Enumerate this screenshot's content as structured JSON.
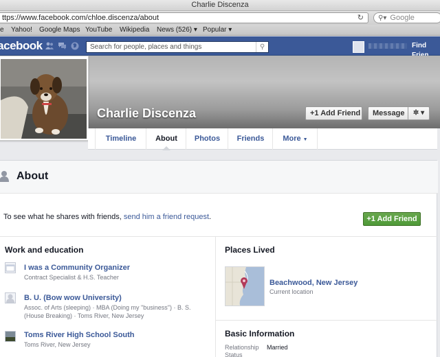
{
  "browser": {
    "window_title": "Charlie Discenza",
    "url": "ttps://www.facebook.com/chloe.discenza/about",
    "search_placeholder": "Google",
    "bookmarks": [
      "e",
      "Yahoo!",
      "Google Maps",
      "YouTube",
      "Wikipedia",
      "News (526) ▾",
      "Popular ▾"
    ]
  },
  "fb": {
    "logo": "facebook",
    "search_placeholder": "Search for people, places and things",
    "find_friends": "Find Frien"
  },
  "profile": {
    "name": "Charlie Discenza",
    "add_friend_label": "+1 Add Friend",
    "message_label": "Message",
    "gear_label": "✲ ▾"
  },
  "tabs": [
    {
      "label": "Timeline",
      "active": false
    },
    {
      "label": "About",
      "active": true
    },
    {
      "label": "Photos",
      "active": false
    },
    {
      "label": "Friends",
      "active": false
    },
    {
      "label": "More",
      "active": false
    }
  ],
  "about": {
    "title": "About",
    "share_prefix": "To see what he shares with friends, ",
    "share_link": "send him a friend request",
    "share_suffix": ".",
    "add_friend_label": "+1 Add Friend"
  },
  "work": {
    "title": "Work and education",
    "items": [
      {
        "title": "I was a Community Organizer",
        "sub": "Contract Specialist & H.S. Teacher"
      },
      {
        "title": "B. U. (Bow wow University)",
        "sub": "Assoc. of Arts (sleeping) · MBA (Doing my \"business\") · B. S. (House Breaking) · Toms River, New Jersey"
      },
      {
        "title": "Toms River High School South",
        "sub": "Toms River, New Jersey"
      }
    ]
  },
  "places": {
    "title": "Places Lived",
    "place": "Beachwood, New Jersey",
    "place_sub": "Current location"
  },
  "basic": {
    "title": "Basic Information",
    "label": "Relationship Status",
    "value": "Married"
  },
  "colors": {
    "fb_blue": "#3b5998",
    "green": "#4e9a38"
  }
}
